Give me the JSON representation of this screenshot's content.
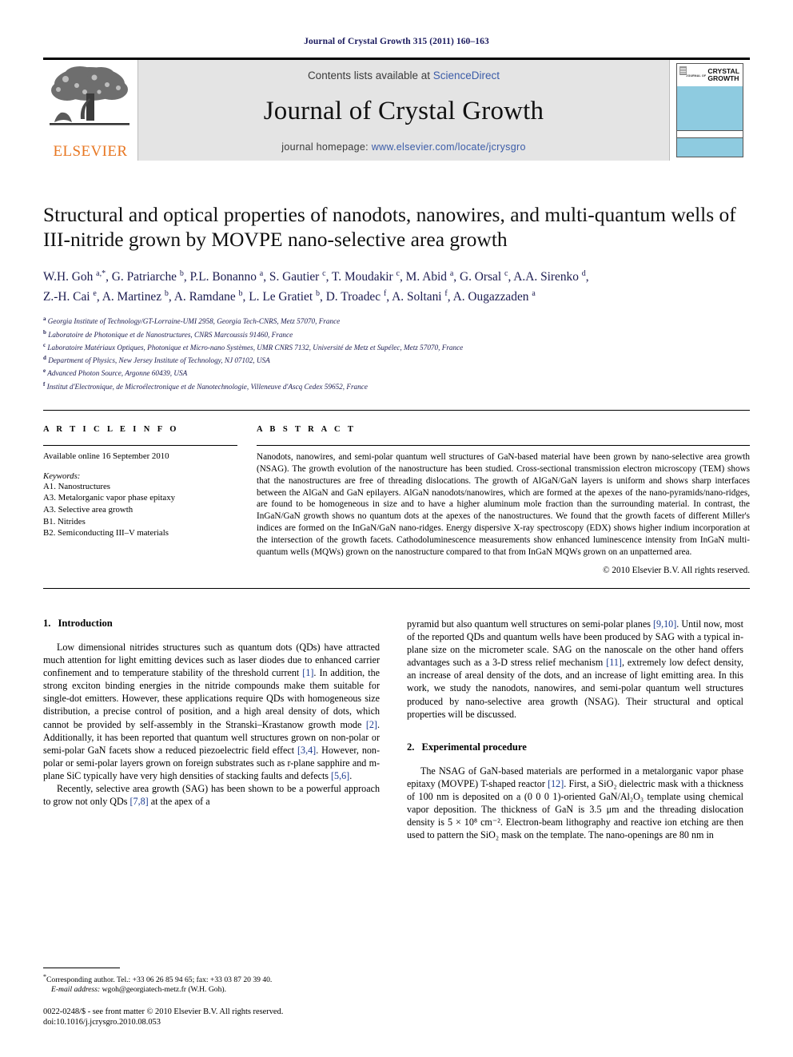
{
  "running_head": "Journal of Crystal Growth 315 (2011) 160–163",
  "masthead": {
    "publisher_name": "ELSEVIER",
    "contents_prefix": "Contents lists available at ",
    "contents_link": "ScienceDirect",
    "journal_title": "Journal of Crystal Growth",
    "homepage_prefix": "journal homepage: ",
    "homepage_url": "www.elsevier.com/locate/jcrysgro",
    "cover": {
      "journal_of": "JOURNAL OF",
      "name_line1": "CRYSTAL",
      "name_line2": "GROWTH"
    },
    "accent_link_color": "#3b5ca8",
    "elsevier_orange": "#E87722",
    "cover_band_color": "#8ecbe0"
  },
  "article": {
    "title": "Structural and optical properties of nanodots, nanowires, and multi-quantum wells of III-nitride grown by MOVPE nano-selective area growth",
    "authors_line1": "W.H. Goh a,*, G. Patriarche b, P.L. Bonanno a, S. Gautier c, T. Moudakir c, M. Abid a, G. Orsal c, A.A. Sirenko d,",
    "authors_line2": "Z.-H. Cai e, A. Martinez b, A. Ramdane b, L. Le Gratiet b, D. Troadec f, A. Soltani f, A. Ougazzaden a",
    "affiliations": [
      {
        "mark": "a",
        "text": "Georgia Institute of Technology/GT-Lorraine-UMI 2958, Georgia Tech-CNRS, Metz 57070, France"
      },
      {
        "mark": "b",
        "text": "Laboratoire de Photonique et de Nanostructures, CNRS Marcoussis 91460, France"
      },
      {
        "mark": "c",
        "text": "Laboratoire Matériaux Optiques, Photonique et Micro-nano Systèmes, UMR CNRS 7132, Université de Metz et Supélec, Metz 57070, France"
      },
      {
        "mark": "d",
        "text": "Department of Physics, New Jersey Institute of Technology, NJ 07102, USA"
      },
      {
        "mark": "e",
        "text": "Advanced Photon Source, Argonne 60439, USA"
      },
      {
        "mark": "f",
        "text": "Institut d'Electronique, de Microélectronique et de Nanotechnologie, Villeneuve d'Ascq Cedex 59652, France"
      }
    ]
  },
  "article_info": {
    "label": "A R T I C L E  I N F O",
    "available_online": "Available online 16 September 2010",
    "keywords_label": "Keywords:",
    "keywords": [
      "A1. Nanostructures",
      "A3. Metalorganic vapor phase epitaxy",
      "A3. Selective area growth",
      "B1. Nitrides",
      "B2. Semiconducting III–V materials"
    ]
  },
  "abstract": {
    "label": "A B S T R A C T",
    "text": "Nanodots, nanowires, and semi-polar quantum well structures of GaN-based material have been grown by nano-selective area growth (NSAG). The growth evolution of the nanostructure has been studied. Cross-sectional transmission electron microscopy (TEM) shows that the nanostructures are free of threading dislocations. The growth of AlGaN/GaN layers is uniform and shows sharp interfaces between the AlGaN and GaN epilayers. AlGaN nanodots/nanowires, which are formed at the apexes of the nano-pyramids/nano-ridges, are found to be homogeneous in size and to have a higher aluminum mole fraction than the surrounding material. In contrast, the InGaN/GaN growth shows no quantum dots at the apexes of the nanostructures. We found that the growth facets of different Miller's indices are formed on the InGaN/GaN nano-ridges. Energy dispersive X-ray spectroscopy (EDX) shows higher indium incorporation at the intersection of the growth facets. Cathodoluminescence measurements show enhanced luminescence intensity from InGaN multi-quantum wells (MQWs) grown on the nanostructure compared to that from InGaN MQWs grown on an unpatterned area.",
    "copyright": "© 2010 Elsevier B.V. All rights reserved."
  },
  "sections": {
    "introduction": {
      "number": "1.",
      "heading": "Introduction",
      "para1_a": "Low dimensional nitrides structures such as quantum dots (QDs) have attracted much attention for light emitting devices such as laser diodes due to enhanced carrier confinement and to temperature stability of the threshold current ",
      "para1_ref1": "[1]",
      "para1_b": ". In addition, the strong exciton binding energies in the nitride compounds make them suitable for single-dot emitters. However, these applications require QDs with homogeneous size distribution, a precise control of position, and a high areal density of dots, which cannot be provided by self-assembly in the Stranski–Krastanow growth mode ",
      "para1_ref2": "[2]",
      "para1_c": ". Additionally, it has been reported that quantum well structures grown on non-polar or semi-polar GaN facets show a reduced piezoelectric field effect ",
      "para1_ref3": "[3,4]",
      "para1_d": ". However, non-polar or semi-polar layers grown on foreign substrates such as r-plane sapphire and m-plane SiC typically have very high densities of stacking faults and defects ",
      "para1_ref4": "[5,6]",
      "para1_e": ".",
      "para2_a": "Recently, selective area growth (SAG) has been shown to be a powerful approach to grow not only QDs ",
      "para2_ref1": "[7,8]",
      "para2_b": " at the apex of a pyramid but also quantum well structures on semi-polar planes ",
      "para2_ref2": "[9,10]",
      "para2_c": ". Until now, most of the reported QDs and quantum wells have been produced by SAG with a typical in-plane size on the micrometer scale. SAG on the nanoscale on the other hand offers advantages such as a 3-D stress relief mechanism ",
      "para2_ref3": "[11]",
      "para2_d": ", extremely low defect density, an increase of areal density of the dots, and an increase of light emitting area. In this work, we study the nanodots, nanowires, and semi-polar quantum well structures produced by nano-selective area growth (NSAG). Their structural and optical properties will be discussed."
    },
    "experimental": {
      "number": "2.",
      "heading": "Experimental procedure",
      "para1_a": "The NSAG of GaN-based materials are performed in a metalorganic vapor phase epitaxy (MOVPE) T-shaped reactor ",
      "para1_ref1": "[12]",
      "para1_b": ". First, a SiO₂ dielectric mask with a thickness of 100 nm is deposited on a (0 0 0 1)-oriented GaN/Al₂O₃ template using chemical vapor deposition. The thickness of GaN is 3.5 μm and the threading dislocation density is 5 × 10⁸ cm⁻². Electron-beam lithography and reactive ion etching are then used to pattern the SiO₂ mask on the template. The nano-openings are 80 nm in"
    }
  },
  "footnotes": {
    "corresponding_mark": "*",
    "corresponding": "Corresponding author. Tel.: +33 06 26 85 94 65; fax: +33 03 87 20 39 40.",
    "email_label": "E-mail address:",
    "email": "wgoh@georgiatech-metz.fr (W.H. Goh).",
    "issn_line": "0022-0248/$ - see front matter © 2010 Elsevier B.V. All rights reserved.",
    "doi_line": "doi:10.1016/j.jcrysgro.2010.08.053"
  }
}
